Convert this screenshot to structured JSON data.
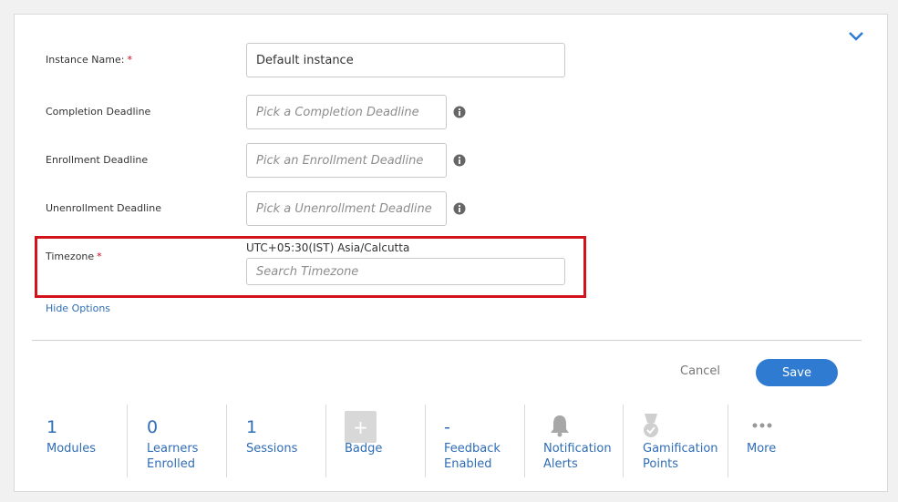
{
  "form": {
    "instance_name_label": "Instance Name:",
    "instance_name_value": "Default instance",
    "completion_label": "Completion Deadline",
    "completion_placeholder": "Pick a Completion Deadline",
    "enrollment_label": "Enrollment Deadline",
    "enrollment_placeholder": "Pick an Enrollment Deadline",
    "unenrollment_label": "Unenrollment Deadline",
    "unenrollment_placeholder": "Pick a Unenrollment Deadline",
    "timezone_label": "Timezone",
    "timezone_value": "UTC+05:30(IST) Asia/Calcutta",
    "timezone_placeholder": "Search Timezone",
    "required_mark": "*",
    "hide_options": "Hide Options"
  },
  "actions": {
    "cancel": "Cancel",
    "save": "Save"
  },
  "stats": {
    "modules_count": "1",
    "modules_label": "Modules",
    "learners_count": "0",
    "learners_label_1": "Learners",
    "learners_label_2": "Enrolled",
    "sessions_count": "1",
    "sessions_label": "Sessions",
    "badge_label": "Badge",
    "feedback_value": "-",
    "feedback_label_1": "Feedback",
    "feedback_label_2": "Enabled",
    "notification_label_1": "Notification",
    "notification_label_2": "Alerts",
    "gamification_label_1": "Gamification",
    "gamification_label_2": "Points",
    "more_label": "More"
  },
  "icons": {
    "collapse": "chevron-down-icon",
    "info": "info-icon",
    "badge": "plus-icon",
    "notification": "bell-icon",
    "gamification": "medal-icon",
    "more": "ellipsis-icon"
  },
  "colors": {
    "accent": "#2f7bd2",
    "link": "#2f6db7",
    "required": "#d0021b",
    "highlight": "#d3131b"
  }
}
